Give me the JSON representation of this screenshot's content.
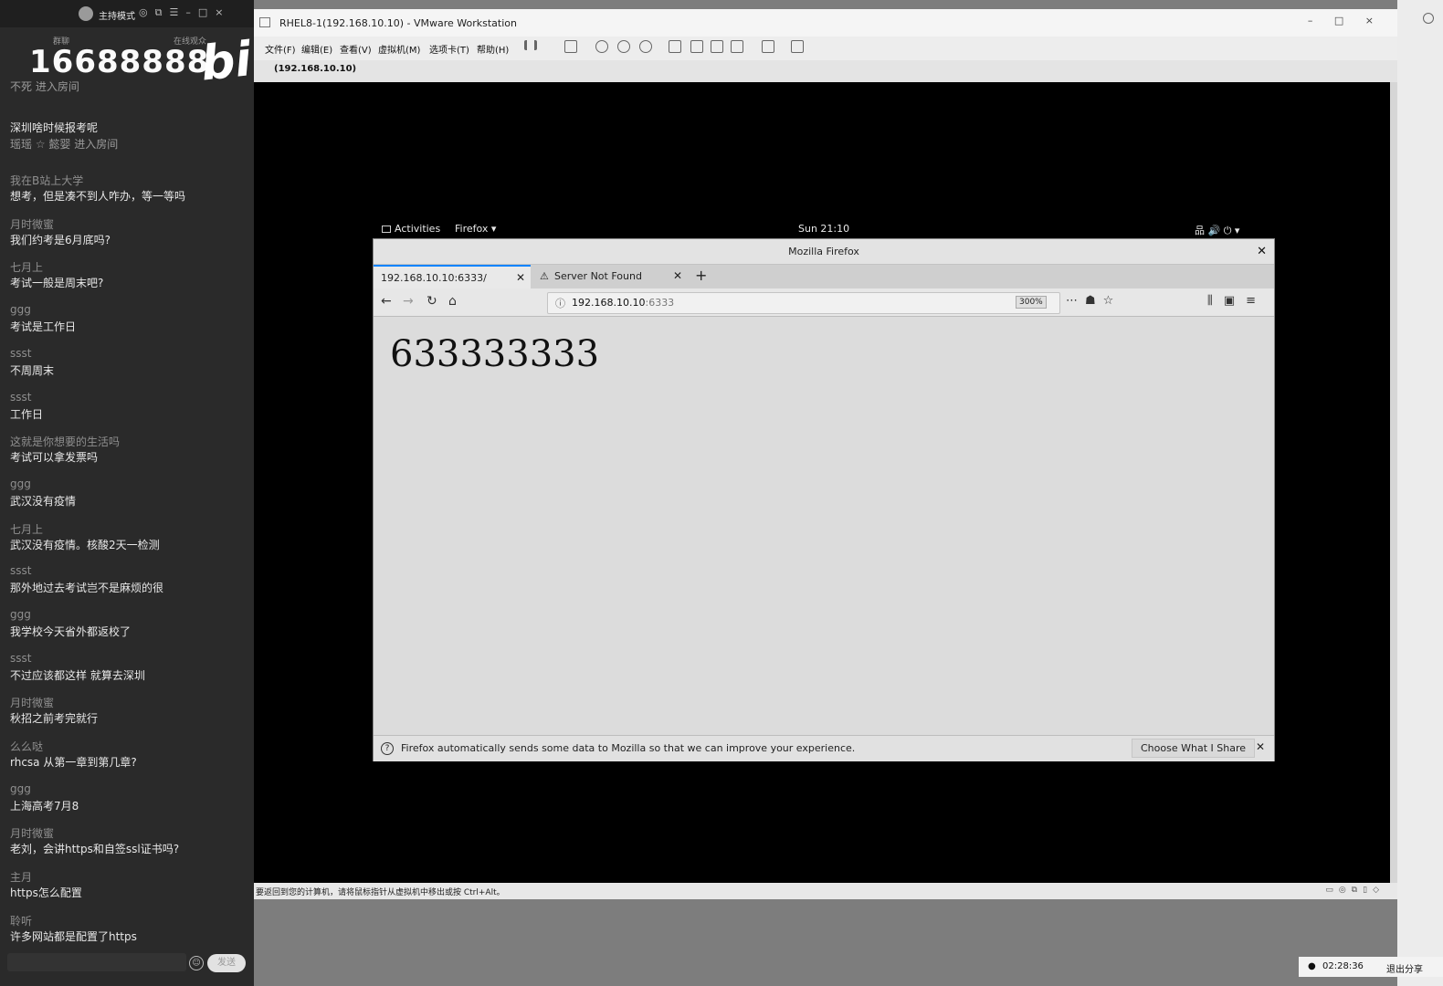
{
  "chat": {
    "host_mode": "主持模式",
    "tabs": [
      "群聊",
      "在线观众"
    ],
    "watermark_number": "16688888",
    "watermark_logo": "bili",
    "messages": [
      {
        "name": "不死 进入房间",
        "text": ""
      },
      {
        "name": "",
        "text": "深圳啥时候报考呢"
      },
      {
        "name": "瑶瑶 ☆ 懿婴 进入房间",
        "text": ""
      },
      {
        "name": "我在B站上大学",
        "text": "想考，但是凑不到人咋办，等一等吗"
      },
      {
        "name": "月时微蜜",
        "text": "我们约考是6月底吗?"
      },
      {
        "name": "七月上",
        "text": "考试一般是周末吧?"
      },
      {
        "name": "ggg",
        "text": "考试是工作日"
      },
      {
        "name": "ssst",
        "text": "不周周末"
      },
      {
        "name": "ssst",
        "text": "工作日"
      },
      {
        "name": "这就是你想要的生活吗",
        "text": "考试可以拿发票吗"
      },
      {
        "name": "ggg",
        "text": "武汉没有疫情"
      },
      {
        "name": "七月上",
        "text": "武汉没有疫情。核酸2天一检测"
      },
      {
        "name": "ssst",
        "text": "那外地过去考试岂不是麻烦的很"
      },
      {
        "name": "ggg",
        "text": "我学校今天省外都返校了"
      },
      {
        "name": "ssst",
        "text": "不过应该都这样 就算去深圳"
      },
      {
        "name": "月时微蜜",
        "text": "秋招之前考完就行"
      },
      {
        "name": "么么哒",
        "text": "rhcsa 从第一章到第几章?"
      },
      {
        "name": "ggg",
        "text": "上海高考7月8"
      },
      {
        "name": "月时微蜜",
        "text": "老刘，会讲https和自签ssl证书吗?"
      },
      {
        "name": "主月",
        "text": "https怎么配置"
      },
      {
        "name": "聆听",
        "text": "许多网站都是配置了https"
      }
    ],
    "send_label": "发送"
  },
  "vmware": {
    "title": "RHEL8-1(192.168.10.10) - VMware Workstation",
    "menu": [
      "文件(F)",
      "编辑(E)",
      "查看(V)",
      "虚拟机(M)",
      "选项卡(T)",
      "帮助(H)"
    ],
    "tab_label": "(192.168.10.10)",
    "status_message": "要返回到您的计算机，请将鼠标指针从虚拟机中移出或按 Ctrl+Alt。"
  },
  "gnome": {
    "activities": "Activities",
    "app_menu": "Firefox ▾",
    "clock": "Sun 21:10",
    "tray": "品  🔊  ⏻ ▾"
  },
  "firefox": {
    "window_title": "Mozilla Firefox",
    "tabs": [
      {
        "label": "192.168.10.10:6333/",
        "active": true
      },
      {
        "label": "Server Not Found",
        "active": false
      }
    ],
    "url_host": "192.168.10.10",
    "url_port": ":6333",
    "zoom": "300%",
    "page_text": "633333333",
    "notice_text": "Firefox automatically sends some data to Mozilla so that we can improve your experience.",
    "notice_button": "Choose What I Share"
  },
  "system": {
    "time": "02:28:36",
    "exit_share": "退出分享"
  },
  "colors": {
    "chat_bg": "#2a2a2a",
    "vm_screen_bg": "#000000",
    "firefox_accent": "#0a84ff"
  }
}
